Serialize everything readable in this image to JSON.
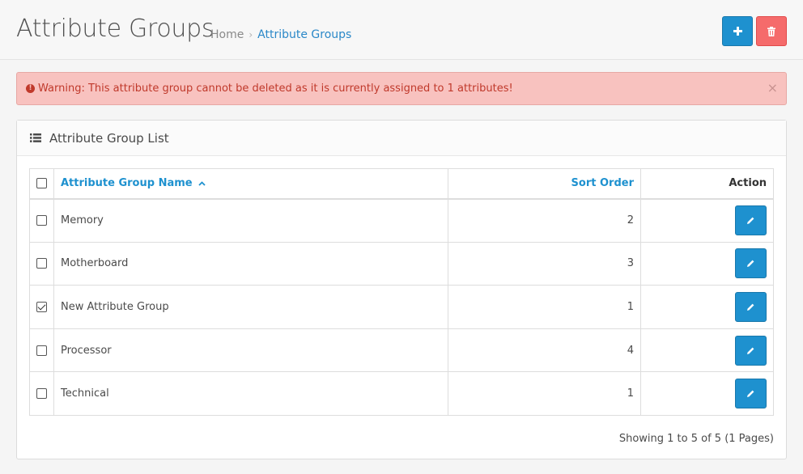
{
  "header": {
    "title": "Attribute Groups",
    "breadcrumb": {
      "home": "Home",
      "separator": "›",
      "current": "Attribute Groups"
    },
    "add_button_icon": "plus-icon",
    "delete_button_icon": "trash-icon"
  },
  "alert": {
    "icon": "exclamation-circle-icon",
    "text": "Warning: This attribute group cannot be deleted as it is currently assigned to 1 attributes!",
    "close": "×"
  },
  "panel": {
    "icon": "list-icon",
    "title": "Attribute Group List"
  },
  "table": {
    "columns": {
      "name": "Attribute Group Name",
      "sort_order": "Sort Order",
      "action": "Action"
    },
    "sort_indicator": "^",
    "rows": [
      {
        "name": "Memory",
        "sort_order": "2",
        "checked": false
      },
      {
        "name": "Motherboard",
        "sort_order": "3",
        "checked": false
      },
      {
        "name": "New Attribute Group",
        "sort_order": "1",
        "checked": true
      },
      {
        "name": "Processor",
        "sort_order": "4",
        "checked": false
      },
      {
        "name": "Technical",
        "sort_order": "1",
        "checked": false
      }
    ]
  },
  "pagination": {
    "text": "Showing 1 to 5 of 5 (1 Pages)"
  },
  "colors": {
    "primary": "#1e91cf",
    "danger": "#f56b6b",
    "alert_bg": "#f8c2bf",
    "alert_text": "#c0392b"
  }
}
